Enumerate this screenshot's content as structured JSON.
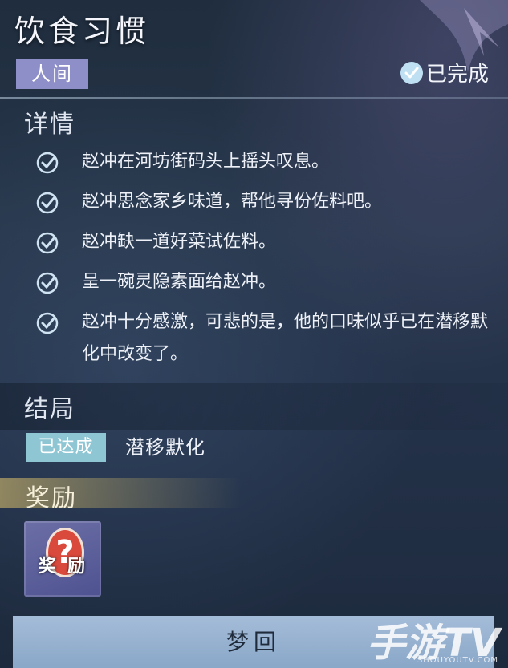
{
  "header": {
    "title": "饮食习惯"
  },
  "tags": {
    "realm": "人间",
    "status": "已完成"
  },
  "details": {
    "heading": "详情",
    "items": [
      {
        "text": "赵冲在河坊街码头上摇头叹息。"
      },
      {
        "text": "赵冲思念家乡味道，帮他寻份佐料吧。"
      },
      {
        "text": "赵冲缺一道好菜试佐料。"
      },
      {
        "text": "呈一碗灵隐素面给赵冲。"
      },
      {
        "text": "赵冲十分感激，可悲的是，他的口味似乎已在潜移默化中改变了。"
      }
    ]
  },
  "ending": {
    "heading": "结局",
    "status_tag": "已达成",
    "name": "潜移默化"
  },
  "reward": {
    "heading": "奖励",
    "item_text_left": "奖",
    "item_text_right": "励",
    "item_symbol": "?"
  },
  "footer": {
    "button_label": "梦回"
  },
  "watermark": {
    "text": "手游TV",
    "url": "SHOUYOUTV.COM"
  },
  "colors": {
    "realm_tag": "#8e8fc8",
    "done_tag": "#8fc6d4",
    "check": "#bfe0f3",
    "button": "#9db5d3"
  }
}
